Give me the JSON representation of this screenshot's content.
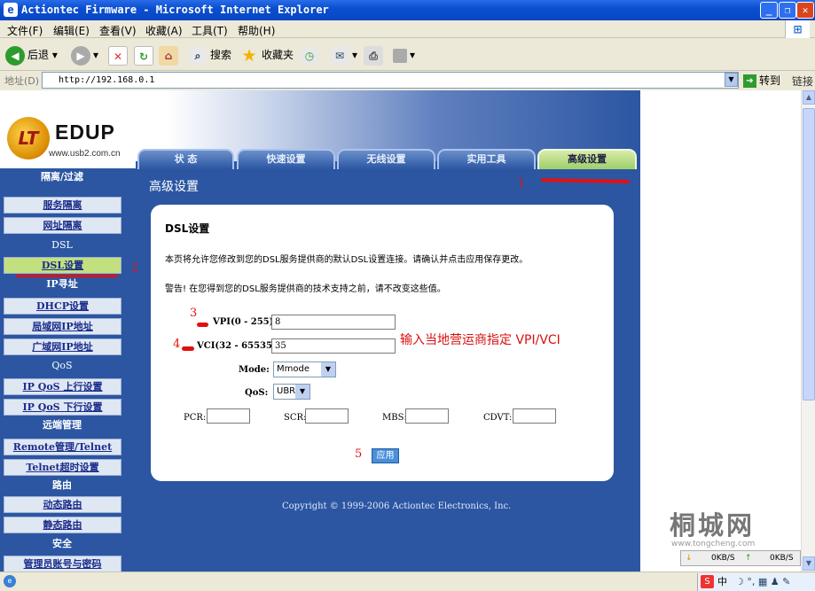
{
  "window": {
    "title": "Actiontec Firmware - Microsoft Internet Explorer"
  },
  "menu": [
    "文件(F)",
    "编辑(E)",
    "查看(V)",
    "收藏(A)",
    "工具(T)",
    "帮助(H)"
  ],
  "toolbar": {
    "back": "后退",
    "search": "搜索",
    "favorites": "收藏夹"
  },
  "address": {
    "label": "地址(D)",
    "url": "http://192.168.0.1",
    "go": "转到",
    "links": "链接"
  },
  "logo": {
    "name": "EDUP",
    "url": "www.usb2.com.cn",
    "mark": "LT"
  },
  "tabs": [
    "状 态",
    "快速设置",
    "无线设置",
    "实用工具",
    "高级设置"
  ],
  "sidebar": {
    "h_isolation": "隔离/过滤",
    "service_isolation": "服务隔离",
    "addr_isolation": "网址隔离",
    "h_dsl": "DSL",
    "dsl_settings": "DSL设置",
    "h_ip": "IP寻址",
    "dhcp": "DHCP设置",
    "lan_ip": "局域网IP地址",
    "wan_ip": "广域网IP地址",
    "h_qos": "QoS",
    "qos_up": "IP QoS 上行设置",
    "qos_down": "IP QoS 下行设置",
    "h_remote": "远端管理",
    "remote": "Remote管理/Telnet",
    "telnet_timeout": "Telnet超时设置",
    "h_route": "路由",
    "dynamic_route": "动态路由",
    "static_route": "静态路由",
    "h_security": "安全",
    "admin_account": "管理员账号与密码"
  },
  "page": {
    "title": "高级设置"
  },
  "panel": {
    "heading": "DSL设置",
    "desc": "本页将允许您修改到您的DSL服务提供商的默认DSL设置连接。请确认并点击应用保存更改。",
    "warning": "警告! 在您得到您的DSL服务提供商的技术支持之前，请不改变这些值。"
  },
  "form": {
    "vpi_label": "VPI(0 - 255):",
    "vpi_value": "8",
    "vci_label": "VCI(32 - 65535):",
    "vci_value": "35",
    "mode_label": "Mode:",
    "mode_value": "Mmode",
    "qos_label": "QoS:",
    "qos_value": "UBR",
    "pcr_label": "PCR:",
    "scr_label": "SCR:",
    "mbs_label": "MBS:",
    "cdvt_label": "CDVT:",
    "apply": "应用"
  },
  "footer": {
    "copyright": "Copyright © 1999-2006 Actiontec Electronics, Inc."
  },
  "annotations": {
    "n1": "1",
    "n2": "2",
    "n3": "3",
    "n4": "4",
    "n5": "5",
    "hint": "输入当地营运商指定 VPI/VCI",
    "color": "#e31010"
  },
  "watermark": {
    "text": "桐城网",
    "url": "www.tongcheng.com"
  },
  "netmeter": {
    "down": "0KB/S",
    "up": "0KB/S"
  },
  "status": {
    "ime": "中"
  },
  "colors": {
    "page_bg": "#2c56a2",
    "active_tab": "#9dcf6a",
    "active_item": "#c2e07e"
  }
}
